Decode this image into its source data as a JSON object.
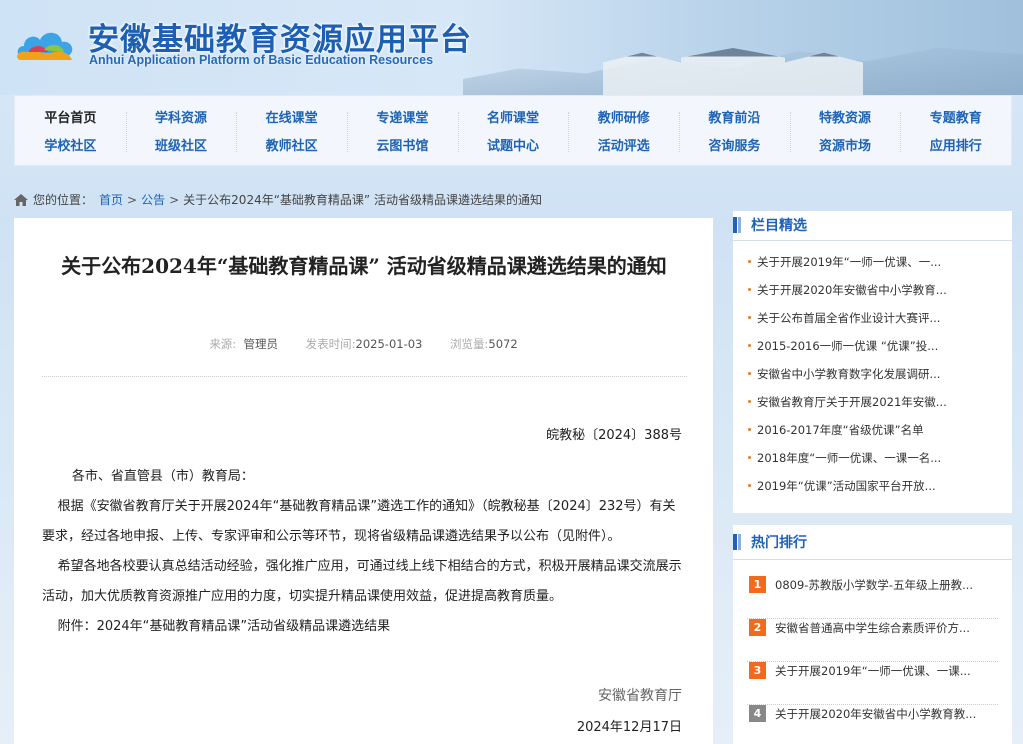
{
  "header": {
    "title": "安徽基础教育资源应用平台",
    "subtitle": "Anhui Application Platform of Basic Education Resources"
  },
  "nav": {
    "columns": [
      [
        "平台首页",
        "学校社区"
      ],
      [
        "学科资源",
        "班级社区"
      ],
      [
        "在线课堂",
        "教师社区"
      ],
      [
        "专递课堂",
        "云图书馆"
      ],
      [
        "名师课堂",
        "试题中心"
      ],
      [
        "教师研修",
        "活动评选"
      ],
      [
        "教育前沿",
        "咨询服务"
      ],
      [
        "特教资源",
        "资源市场"
      ],
      [
        "专题教育",
        "应用排行"
      ]
    ]
  },
  "breadcrumb": {
    "prefix": "您的位置：",
    "home": "首页",
    "section": "公告",
    "sep": ">",
    "current": "关于公布2024年“基础教育精品课” 活动省级精品课遴选结果的通知"
  },
  "article": {
    "title": "关于公布2024年“基础教育精品课” 活动省级精品课遴选结果的通知",
    "meta": {
      "source_label": "来源:",
      "source": "管理员",
      "time_label": "发表时间:",
      "time": "2025-01-03",
      "views_label": "浏览量:",
      "views": "5072"
    },
    "doc_no": "皖教秘〔2024〕388号",
    "salutation": "各市、省直管县（市）教育局：",
    "para1": "根据《安徽省教育厅关于开展2024年“基础教育精品课”遴选工作的通知》（皖教秘基〔2024〕232号）有关要求，经过各地申报、上传、专家评审和公示等环节，现将省级精品课遴选结果予以公布（见附件）。",
    "para2": "希望各地各校要认真总结活动经验，强化推广应用，可通过线上线下相结合的方式，积极开展精品课交流展示活动，加大优质教育资源推广应用的力度，切实提升精品课使用效益，促进提高教育质量。",
    "attachment": "附件：2024年“基础教育精品课”活动省级精品课遴选结果",
    "sign_org": "安徽省教育厅",
    "sign_date": "2024年12月17日"
  },
  "featured": {
    "title": "栏目精选",
    "items": [
      "关于开展2019年“一师一优课、一...",
      "关于开展2020年安徽省中小学教育...",
      "关于公布首届全省作业设计大赛评...",
      "2015-2016一师一优课 “优课”投...",
      "安徽省中小学教育数字化发展调研...",
      "安徽省教育厅关于开展2021年安徽...",
      "2016-2017年度“省级优课”名单",
      "2018年度“一师一优课、一课一名...",
      "2019年“优课”活动国家平台开放..."
    ]
  },
  "hot": {
    "title": "热门排行",
    "items": [
      {
        "rank": "1",
        "text": "0809-苏教版小学数学-五年级上册教...",
        "color": "#f26b1d"
      },
      {
        "rank": "2",
        "text": "安徽省普通高中学生综合素质评价方...",
        "color": "#f26b1d"
      },
      {
        "rank": "3",
        "text": "关于开展2019年“一师一优课、一课...",
        "color": "#f26b1d"
      },
      {
        "rank": "4",
        "text": "关于开展2020年安徽省中小学教育教...",
        "color": "#888888"
      }
    ]
  }
}
